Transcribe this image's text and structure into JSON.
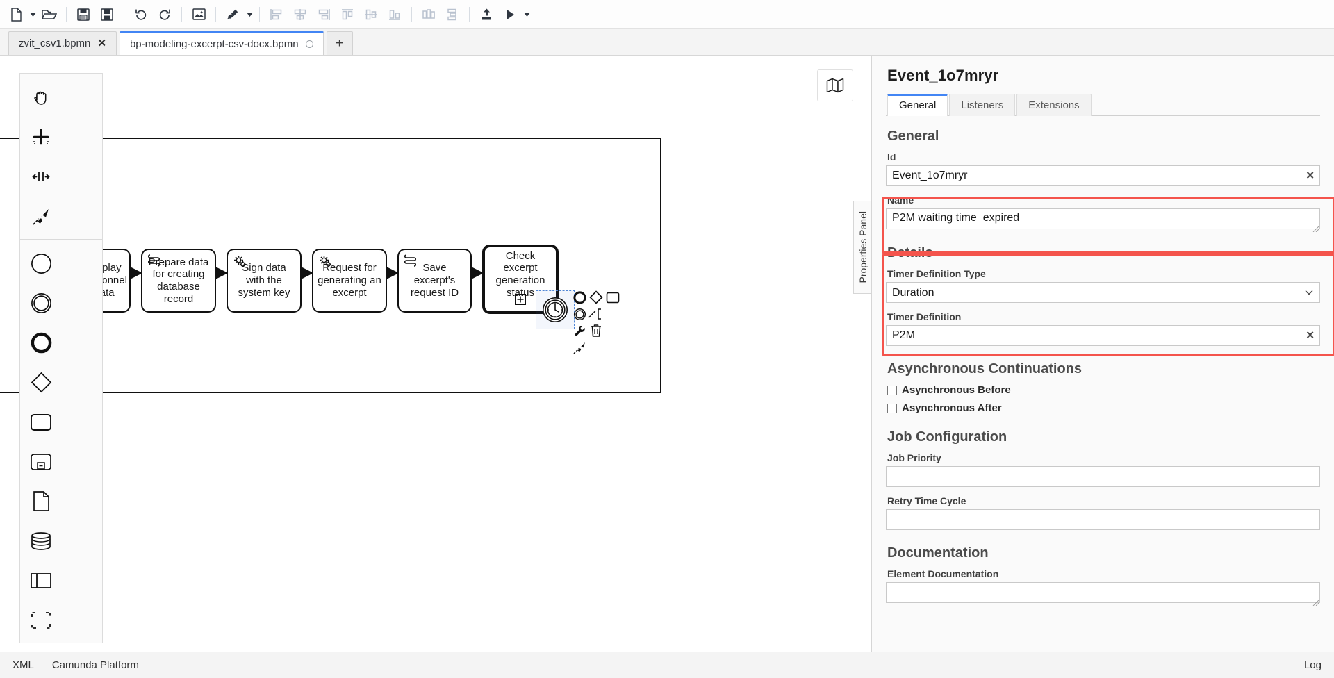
{
  "toolbar": {
    "buttons": [
      {
        "name": "new-diagram-button",
        "icon": "file-new-icon",
        "disabled": false
      },
      {
        "name": "new-diagram-dropdown",
        "icon": "caret-down-icon",
        "disabled": false
      },
      {
        "name": "open-file-button",
        "icon": "folder-open-icon",
        "disabled": false
      },
      {
        "name": "save-button",
        "icon": "save-icon",
        "disabled": false
      },
      {
        "name": "save-as-button",
        "icon": "save-as-icon",
        "disabled": false
      },
      {
        "name": "undo-button",
        "icon": "undo-icon",
        "disabled": false
      },
      {
        "name": "redo-button",
        "icon": "redo-icon",
        "disabled": false
      },
      {
        "name": "export-image-button",
        "icon": "image-export-icon",
        "disabled": false
      },
      {
        "name": "color-picker-button",
        "icon": "paintbrush-icon",
        "disabled": false
      },
      {
        "name": "color-picker-dropdown",
        "icon": "caret-down-icon",
        "disabled": false
      },
      {
        "name": "align-left-button",
        "icon": "align-left-icon",
        "disabled": true
      },
      {
        "name": "align-center-button",
        "icon": "align-center-icon",
        "disabled": true
      },
      {
        "name": "align-right-button",
        "icon": "align-right-icon",
        "disabled": true
      },
      {
        "name": "align-top-button",
        "icon": "align-top-icon",
        "disabled": true
      },
      {
        "name": "align-middle-button",
        "icon": "align-middle-icon",
        "disabled": true
      },
      {
        "name": "align-bottom-button",
        "icon": "align-bottom-icon",
        "disabled": true
      },
      {
        "name": "distribute-horizontal-button",
        "icon": "distribute-horizontal-icon",
        "disabled": true
      },
      {
        "name": "distribute-vertical-button",
        "icon": "distribute-vertical-icon",
        "disabled": true
      },
      {
        "name": "deploy-button",
        "icon": "upload-icon",
        "disabled": false
      },
      {
        "name": "start-instance-button",
        "icon": "play-icon",
        "disabled": false
      },
      {
        "name": "start-instance-dropdown",
        "icon": "caret-down-icon",
        "disabled": false
      }
    ]
  },
  "tabs": {
    "items": [
      {
        "label": "zvit_csv1.bpmn",
        "active": false,
        "dirty": false,
        "close": "✕"
      },
      {
        "label": "bp-modeling-excerpt-csv-docx.bpmn",
        "active": true,
        "dirty": true
      }
    ],
    "add_label": "+"
  },
  "palette": {
    "tools": [
      {
        "name": "hand-tool",
        "icon": "hand-icon"
      },
      {
        "name": "lasso-tool",
        "icon": "lasso-icon"
      },
      {
        "name": "space-tool",
        "icon": "space-tool-icon"
      },
      {
        "name": "global-connect-tool",
        "icon": "connect-arrow-icon"
      }
    ],
    "elements": [
      {
        "name": "create-start-event",
        "icon": "start-event-icon"
      },
      {
        "name": "create-intermediate-event",
        "icon": "intermediate-event-icon"
      },
      {
        "name": "create-end-event",
        "icon": "end-event-icon"
      },
      {
        "name": "create-gateway",
        "icon": "gateway-diamond-icon"
      },
      {
        "name": "create-task",
        "icon": "task-rect-icon"
      },
      {
        "name": "create-subprocess-collapsed",
        "icon": "subprocess-icon"
      },
      {
        "name": "create-data-object",
        "icon": "data-object-icon"
      },
      {
        "name": "create-data-store",
        "icon": "data-store-icon"
      },
      {
        "name": "create-participant",
        "icon": "participant-pool-icon"
      },
      {
        "name": "create-group",
        "icon": "group-icon"
      }
    ]
  },
  "canvas": {
    "minimap_toggle": "map-icon",
    "nodes": [
      {
        "id": "task-display-personnel-data",
        "label": "Display personnel data",
        "type": "user-task",
        "icon": "none"
      },
      {
        "id": "task-prepare-data",
        "label": "Prepare data for creating database record",
        "type": "script-task",
        "icon": "script-icon"
      },
      {
        "id": "task-sign-data",
        "label": "Sign data with the system key",
        "type": "service-task",
        "icon": "gear-icon"
      },
      {
        "id": "task-request-excerpt",
        "label": "Request for generating an excerpt",
        "type": "service-task",
        "icon": "gear-icon"
      },
      {
        "id": "task-save-request-id",
        "label": "Save excerpt's request ID",
        "type": "script-task",
        "icon": "script-icon"
      },
      {
        "id": "subprocess-check-status",
        "label": "Check excerpt generation status",
        "type": "call-activity",
        "icon": "none",
        "marker": "plus-marker"
      }
    ],
    "selected_element": {
      "id": "timer-boundary-event",
      "type": "timer-boundary-event",
      "icon": "clock-icon"
    },
    "context_pad": [
      {
        "name": "append-end-event",
        "icon": "end-event-icon"
      },
      {
        "name": "append-gateway",
        "icon": "gateway-diamond-icon"
      },
      {
        "name": "append-task",
        "icon": "task-rect-icon"
      },
      {
        "name": "append-intermediate-event",
        "icon": "intermediate-event-icon"
      },
      {
        "name": "append-text-annotation",
        "icon": "text-annotation-icon"
      },
      {
        "name": "change-element-type",
        "icon": "wrench-icon"
      },
      {
        "name": "delete-element",
        "icon": "trash-icon"
      },
      {
        "name": "connect-element",
        "icon": "connect-arrow-icon"
      }
    ]
  },
  "properties": {
    "title": "Event_1o7mryr",
    "handle_label": "Properties Panel",
    "tabs": [
      {
        "label": "General",
        "active": true
      },
      {
        "label": "Listeners",
        "active": false
      },
      {
        "label": "Extensions",
        "active": false
      }
    ],
    "sections": {
      "general": {
        "heading": "General",
        "id_label": "Id",
        "id_value": "Event_1o7mryr",
        "name_label": "Name",
        "name_value": "P2M waiting time  expired"
      },
      "details": {
        "heading": "Details",
        "timer_type_label": "Timer Definition Type",
        "timer_type_value": "Duration",
        "timer_type_options": [
          "Duration"
        ],
        "timer_def_label": "Timer Definition",
        "timer_def_value": "P2M"
      },
      "async": {
        "heading": "Asynchronous Continuations",
        "before_label": "Asynchronous Before",
        "before_checked": false,
        "after_label": "Asynchronous After",
        "after_checked": false
      },
      "job": {
        "heading": "Job Configuration",
        "priority_label": "Job Priority",
        "priority_value": "",
        "retry_label": "Retry Time Cycle",
        "retry_value": ""
      },
      "documentation": {
        "heading": "Documentation",
        "element_doc_label": "Element Documentation",
        "element_doc_value": ""
      }
    },
    "clear_icon": "✕",
    "highlight_color": "#f4544c"
  },
  "statusbar": {
    "left_items": [
      {
        "label": "XML",
        "name": "xml-tab"
      },
      {
        "label": "Camunda Platform",
        "name": "camunda-platform-tab"
      }
    ],
    "right_label": "Log"
  }
}
